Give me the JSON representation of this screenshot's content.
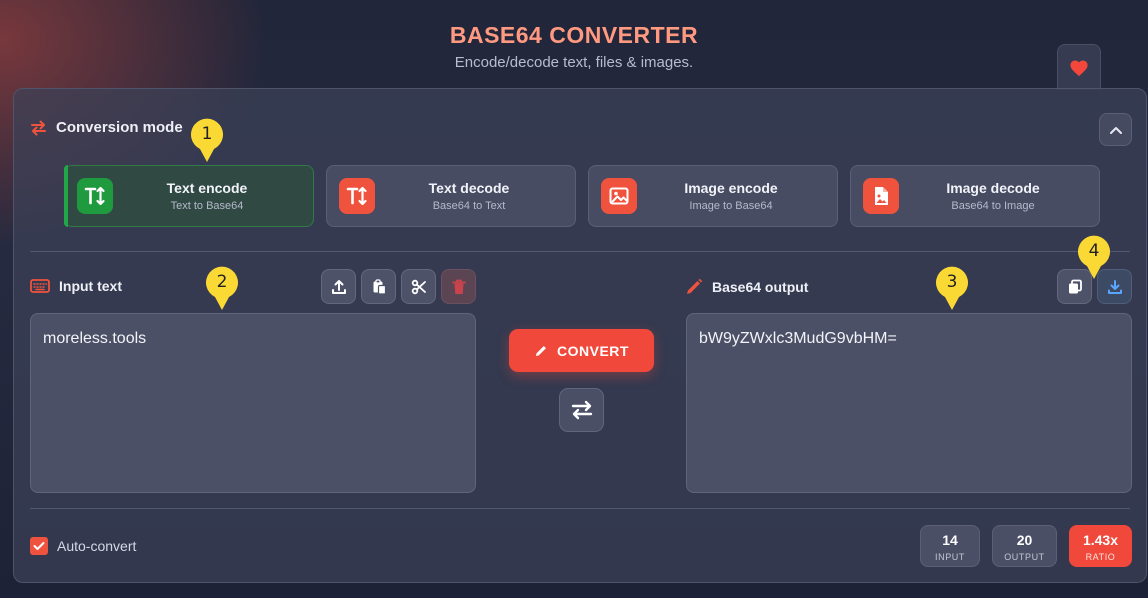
{
  "header": {
    "title": "BASE64 CONVERTER",
    "subtitle": "Encode/decode text, files & images."
  },
  "mode_section": {
    "label": "Conversion mode",
    "modes": [
      {
        "name": "Text encode",
        "desc": "Text to Base64",
        "icon": "text-encode-icon",
        "active": true
      },
      {
        "name": "Text decode",
        "desc": "Base64 to Text",
        "icon": "text-decode-icon",
        "active": false
      },
      {
        "name": "Image encode",
        "desc": "Image to Base64",
        "icon": "image-icon",
        "active": false
      },
      {
        "name": "Image decode",
        "desc": "Base64 to Image",
        "icon": "image-file-icon",
        "active": false
      }
    ]
  },
  "input": {
    "label": "Input text",
    "value": "moreless.tools"
  },
  "output": {
    "label": "Base64 output",
    "value": "bW9yZWxlc3MudG9vbHM="
  },
  "actions": {
    "convert_label": "CONVERT"
  },
  "footer": {
    "auto_convert_label": "Auto-convert",
    "auto_convert_checked": true,
    "stats": [
      {
        "value": "14",
        "label": "INPUT"
      },
      {
        "value": "20",
        "label": "OUTPUT"
      },
      {
        "value": "1.43x",
        "label": "RATIO"
      }
    ]
  },
  "markers": [
    "1",
    "2",
    "3",
    "4"
  ],
  "colors": {
    "accent": "#f0483a",
    "title": "#ff9a80",
    "active_green": "#1f9a3f",
    "marker_yellow": "#fbd935"
  }
}
